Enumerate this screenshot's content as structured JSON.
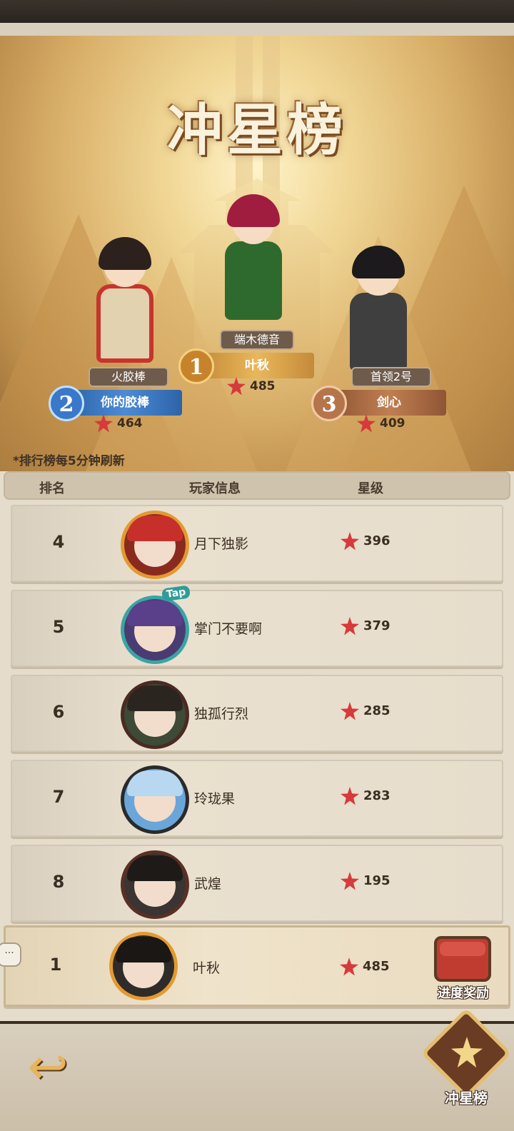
{
  "header": {
    "title": "冲星榜"
  },
  "podium": [
    {
      "rank": "1",
      "title_label": "端木德音",
      "name": "叶秋",
      "stars": "485"
    },
    {
      "rank": "2",
      "title_label": "火胶棒",
      "name": "你的胶棒",
      "stars": "464"
    },
    {
      "rank": "3",
      "title_label": "首领2号",
      "name": "剑心",
      "stars": "409"
    }
  ],
  "note": "*排行榜每5分钟刷新",
  "table": {
    "columns": [
      "排名",
      "玩家信息",
      "星级"
    ],
    "rows": [
      {
        "rank": "4",
        "name": "月下独影",
        "stars": "396"
      },
      {
        "rank": "5",
        "name": "掌门不要啊",
        "stars": "379"
      },
      {
        "rank": "6",
        "name": "独孤行烈",
        "stars": "285"
      },
      {
        "rank": "7",
        "name": "玲珑果",
        "stars": "283"
      },
      {
        "rank": "8",
        "name": "武煌",
        "stars": "195"
      }
    ],
    "tap_tag": "Tap"
  },
  "my_row": {
    "rank": "1",
    "name": "叶秋",
    "stars": "485",
    "reward_label": "进度奖励"
  },
  "chat_tab": "···",
  "bottom": {
    "back_icon": "back-arrow-icon",
    "nav_label": "冲星榜"
  },
  "colors": {
    "star": "#d63a3a",
    "banner_gold": "#f1d796",
    "rank2_blue": "#3a78c9",
    "rank3_copper": "#b5754b"
  }
}
